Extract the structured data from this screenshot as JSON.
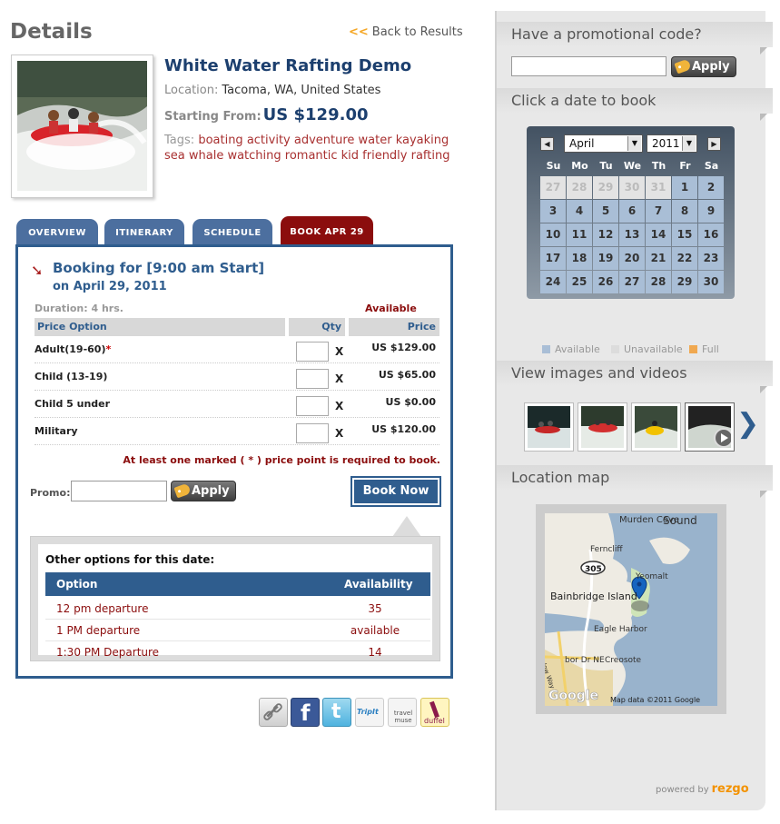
{
  "header": {
    "title": "Details",
    "back_arrows": "<<",
    "back_label": "Back to Results"
  },
  "tour": {
    "title": "White Water Rafting Demo",
    "location_label": "Location:",
    "location": "Tacoma, WA, United States",
    "starting_label": "Starting From:",
    "starting_price": "US $129.00",
    "tags_label": "Tags:",
    "tags": "boating activity adventure water kayaking sea whale watching romantic kid friendly rafting"
  },
  "tabs": [
    {
      "label": "OVERVIEW"
    },
    {
      "label": "ITINERARY"
    },
    {
      "label": "SCHEDULE"
    },
    {
      "label": "BOOK APR 29"
    }
  ],
  "booking": {
    "heading_line1": "Booking for [9:00 am Start]",
    "heading_line2": "on April 29, 2011",
    "duration": "Duration: 4 hrs.",
    "availability": "Available",
    "col_option": "Price Option",
    "col_qty": "Qty",
    "col_price": "Price",
    "rows": [
      {
        "name": "Adult(19-60)",
        "required_mark": "*",
        "x": "X",
        "price": "US $129.00"
      },
      {
        "name": "Child (13-19)",
        "required_mark": "",
        "x": "X",
        "price": "US $65.00"
      },
      {
        "name": "Child 5 under",
        "required_mark": "",
        "x": "X",
        "price": "US $0.00"
      },
      {
        "name": "Military",
        "required_mark": "",
        "x": "X",
        "price": "US $120.00"
      }
    ],
    "required_note": "At least one marked ( * ) price point is required to book.",
    "promo_label": "Promo:",
    "apply_label": "Apply",
    "book_now_label": "Book Now"
  },
  "other_options": {
    "title": "Other options for this date:",
    "col_option": "Option",
    "col_availability": "Availability",
    "rows": [
      {
        "option": "12 pm departure",
        "availability": "35"
      },
      {
        "option": "1 PM departure",
        "availability": "available"
      },
      {
        "option": "1:30 PM Departure",
        "availability": "14"
      }
    ]
  },
  "share_icons": [
    "link-icon",
    "facebook-icon",
    "twitter-icon",
    "tripit-icon",
    "travelmuse-icon",
    "duffel-icon"
  ],
  "share_text": {
    "tripit": "TripIt",
    "travelmuse": "travel muse",
    "duffel": "duffel"
  },
  "sidebar": {
    "promo_heading": "Have a promotional code?",
    "apply_label": "Apply",
    "calendar_heading": "Click a date to book",
    "images_heading": "View images and videos",
    "map_heading": "Location map",
    "powered_by": "powered by",
    "brand": "rezgo"
  },
  "calendar": {
    "prev": "◀",
    "next": "▶",
    "month": "April",
    "year": "2011",
    "weekdays": [
      "Su",
      "Mo",
      "Tu",
      "We",
      "Th",
      "Fr",
      "Sa"
    ],
    "days": [
      "27",
      "28",
      "29",
      "30",
      "31",
      "1",
      "2",
      "3",
      "4",
      "5",
      "6",
      "7",
      "8",
      "9",
      "10",
      "11",
      "12",
      "13",
      "14",
      "15",
      "16",
      "17",
      "18",
      "19",
      "20",
      "21",
      "22",
      "23",
      "24",
      "25",
      "26",
      "27",
      "28",
      "29",
      "30"
    ],
    "legend": [
      {
        "label": "Available",
        "color": "#a9bed6"
      },
      {
        "label": "Unavailable",
        "color": "#dcdcdc"
      },
      {
        "label": "Full",
        "color": "#f0a850"
      }
    ]
  },
  "map": {
    "labels": [
      "Murden Cove",
      "Sound",
      "Ferncliff",
      "305",
      "Yeomalt",
      "Bainbridge Island",
      "Eagle Harbor",
      "Creosote",
      "Winslow Way",
      "bor Dr NE",
      "Google"
    ],
    "attribution": "Map data ©2011 Google"
  },
  "colors": {
    "accent": "#2f5d8e",
    "brand": "#f39200",
    "alert": "#8b0d0d"
  }
}
